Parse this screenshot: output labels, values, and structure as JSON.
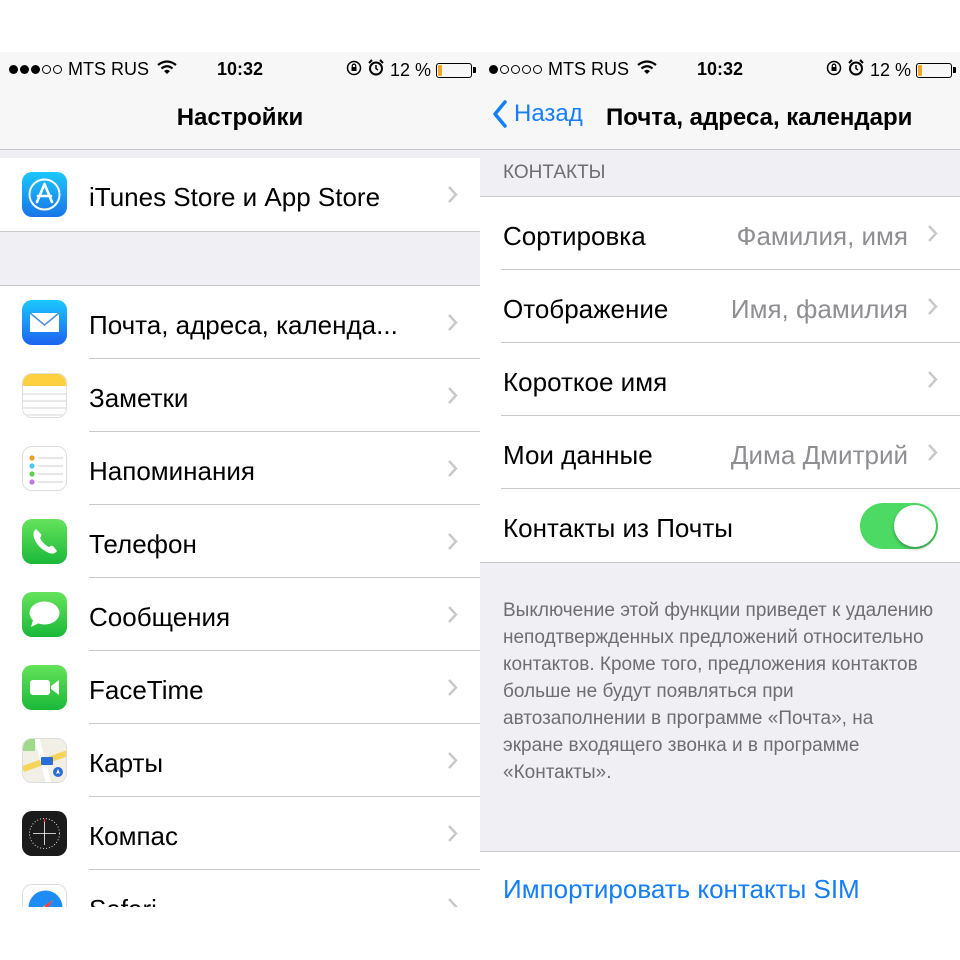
{
  "status_bar": {
    "carrier": "MTS RUS",
    "time": "10:32",
    "battery": "12 %",
    "battery_level": 0.12,
    "battery_color": "#f5a623"
  },
  "left": {
    "title": "Настройки",
    "groups": [
      {
        "items": [
          {
            "label": "iTunes Store и App Store",
            "icon": "app-store-icon"
          }
        ]
      },
      {
        "items": [
          {
            "label": "Почта, адреса, календа...",
            "icon": "mail-icon"
          },
          {
            "label": "Заметки",
            "icon": "notes-icon"
          },
          {
            "label": "Напоминания",
            "icon": "reminders-icon"
          },
          {
            "label": "Телефон",
            "icon": "phone-icon"
          },
          {
            "label": "Сообщения",
            "icon": "messages-icon"
          },
          {
            "label": "FaceTime",
            "icon": "facetime-icon"
          },
          {
            "label": "Карты",
            "icon": "maps-icon"
          },
          {
            "label": "Компас",
            "icon": "compass-icon"
          },
          {
            "label": "Safari",
            "icon": "safari-icon"
          }
        ]
      }
    ]
  },
  "right": {
    "back_label": "Назад",
    "title": "Почта, адреса, календари",
    "section_header": "КОНТАКТЫ",
    "rows": [
      {
        "label": "Сортировка",
        "value": "Фамилия, имя"
      },
      {
        "label": "Отображение",
        "value": "Имя, фамилия"
      },
      {
        "label": "Короткое имя",
        "value": ""
      },
      {
        "label": "Мои данные",
        "value": "Дима Дмитрий"
      },
      {
        "label": "Контакты из Почты",
        "toggle": true
      }
    ],
    "footer": "Выключение этой функции приведет к удалению неподтвержденных предложений относительно контактов. Кроме того, предложения контактов больше не будут появляться при автозаполнении в программе «Почта», на экране входящего звонка и в программе «Контакты».",
    "import_link": "Импортировать контакты SIM"
  },
  "colors": {
    "accent": "#147efb",
    "toggle_on": "#4cd964",
    "group_bg": "#efeff4",
    "separator": "#c8c7cc",
    "secondary_text": "#8e8e93"
  }
}
